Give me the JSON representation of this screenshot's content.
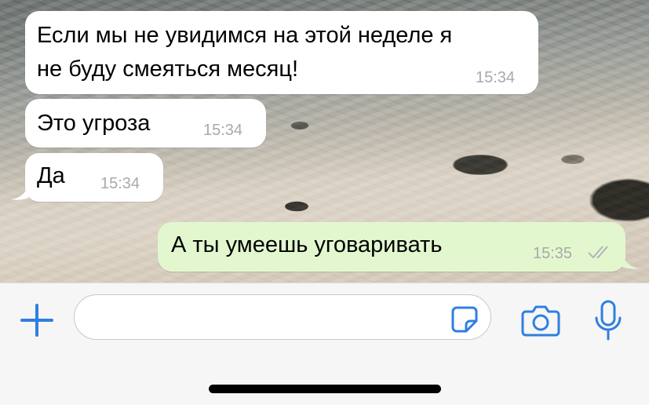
{
  "messages": [
    {
      "direction": "incoming",
      "lines": [
        "Если мы не увидимся на этой неделе я",
        "не буду смеяться месяц!"
      ],
      "time": "15:34"
    },
    {
      "direction": "incoming",
      "lines": [
        "Это угроза"
      ],
      "time": "15:34"
    },
    {
      "direction": "incoming",
      "lines": [
        "Да"
      ],
      "time": "15:34"
    },
    {
      "direction": "outgoing",
      "lines": [
        "А ты умеешь уговаривать"
      ],
      "time": "15:35",
      "status": "read-double-check"
    }
  ],
  "composer": {
    "text_value": "",
    "placeholder": "",
    "icons": [
      "plus-icon",
      "sticker-icon",
      "camera-icon",
      "microphone-icon"
    ]
  },
  "colors": {
    "accent": "#2f7fe0",
    "incoming_bubble": "#ffffff",
    "outgoing_bubble": "#e3f7cf",
    "time_text": "#a9a9a9",
    "home_indicator": "#000000"
  }
}
